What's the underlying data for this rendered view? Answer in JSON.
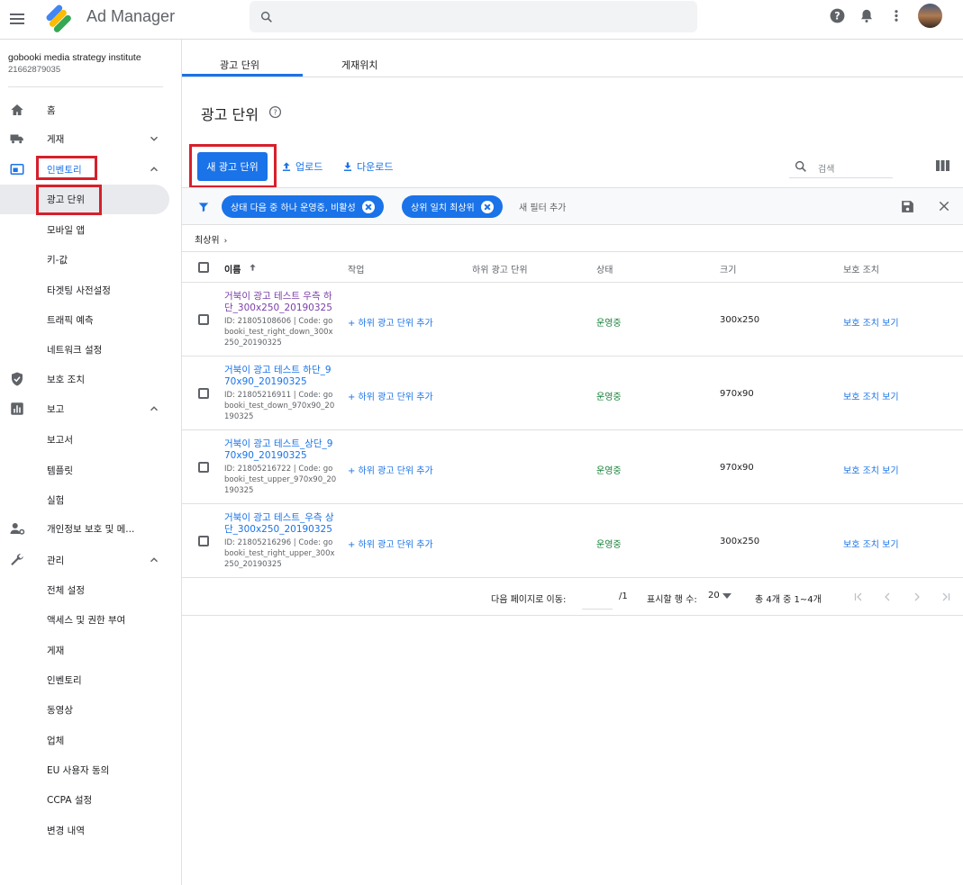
{
  "app": {
    "title": "Ad Manager"
  },
  "org": {
    "name": "gobooki media strategy institute",
    "id": "21662879035"
  },
  "sidebar": {
    "items": [
      {
        "label": "홈",
        "icon": "home-icon"
      },
      {
        "label": "게재",
        "icon": "truck-icon"
      },
      {
        "label": "인벤토리",
        "icon": "inventory-icon"
      },
      {
        "label": "광고 단위"
      },
      {
        "label": "모바일 앱"
      },
      {
        "label": "키-값"
      },
      {
        "label": "타겟팅 사전설정"
      },
      {
        "label": "트래픽 예측"
      },
      {
        "label": "네트워크 설정"
      },
      {
        "label": "보호 조치",
        "icon": "shield-icon"
      },
      {
        "label": "보고",
        "icon": "chart-icon"
      },
      {
        "label": "보고서"
      },
      {
        "label": "템플릿"
      },
      {
        "label": "실험"
      },
      {
        "label": "개인정보 보호 및 메...",
        "icon": "person-settings-icon"
      },
      {
        "label": "관리",
        "icon": "wrench-icon"
      },
      {
        "label": "전체 설정"
      },
      {
        "label": "액세스 및 권한 부여"
      },
      {
        "label": "게재"
      },
      {
        "label": "인벤토리"
      },
      {
        "label": "동영상"
      },
      {
        "label": "업체"
      },
      {
        "label": "EU 사용자 동의"
      },
      {
        "label": "CCPA 설정"
      },
      {
        "label": "변경 내역"
      }
    ]
  },
  "tabs": [
    {
      "label": "광고 단위"
    },
    {
      "label": "게재위치"
    }
  ],
  "page": {
    "title": "광고 단위"
  },
  "toolbar": {
    "new_button": "새 광고 단위",
    "upload": "업로드",
    "download": "다운로드",
    "search_placeholder": "검색"
  },
  "filters": {
    "chips": [
      "상태 다음 중 하나 운영중, 비활성",
      "상위 일치 최상위"
    ],
    "add_filter": "새 필터 추가"
  },
  "breadcrumb": "최상위",
  "table": {
    "headers": [
      "이름",
      "작업",
      "하위 광고 단위",
      "상태",
      "크기",
      "보호 조치"
    ],
    "rows": [
      {
        "name": "거북이 광고 테스트 우측 하단_300x250_20190325",
        "meta": "ID: 21805108606 | Code: gobooki_test_right_down_300x250_20190325",
        "action": "+ 하위 광고 단위 추가",
        "status": "운영중",
        "size": "300x250",
        "protect": "보호 조치 보기"
      },
      {
        "name": "거북이 광고 테스트 하단_970x90_20190325",
        "meta": "ID: 21805216911 | Code: gobooki_test_down_970x90_20190325",
        "action": "+ 하위 광고 단위 추가",
        "status": "운영중",
        "size": "970x90",
        "protect": "보호 조치 보기"
      },
      {
        "name": "거북이 광고 테스트_상단_970x90_20190325",
        "meta": "ID: 21805216722 | Code: gobooki_test_upper_970x90_20190325",
        "action": "+ 하위 광고 단위 추가",
        "status": "운영중",
        "size": "970x90",
        "protect": "보호 조치 보기"
      },
      {
        "name": "거북이 광고 테스트_우측 상단_300x250_20190325",
        "meta": "ID: 21805216296 | Code: gobooki_test_right_upper_300x250_20190325",
        "action": "+ 하위 광고 단위 추가",
        "status": "운영중",
        "size": "300x250",
        "protect": "보호 조치 보기"
      }
    ]
  },
  "pager": {
    "goto_label": "다음 페이지로 이동:",
    "total_pages": "/1",
    "rows_label": "표시할 행 수:",
    "rows_value": "20",
    "range": "총 4개 중 1~4개"
  },
  "colors": {
    "accent": "#1a73e8",
    "highlight": "#d6202b",
    "status_active": "#188038"
  }
}
